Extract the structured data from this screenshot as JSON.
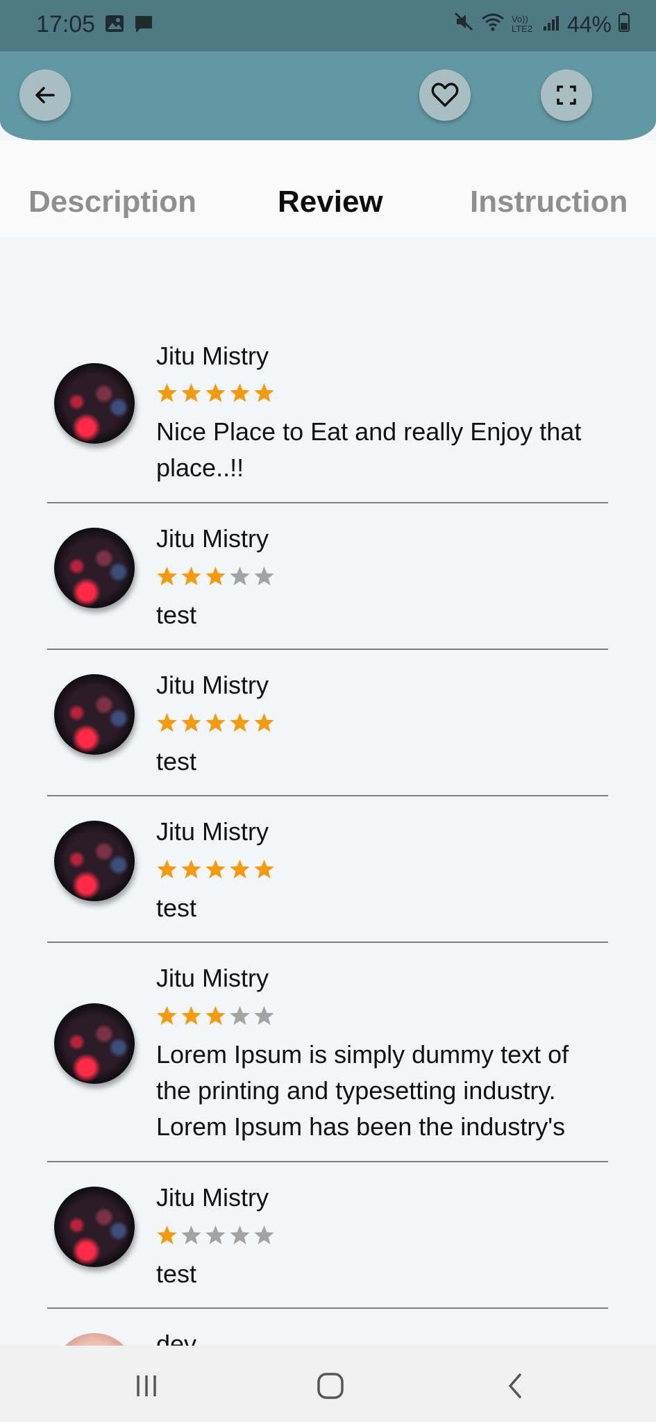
{
  "status_bar": {
    "time": "17:05",
    "battery": "44%",
    "network": "Vo)) LTE2"
  },
  "header": {
    "back_icon": "arrow-left-icon",
    "favorite_icon": "heart-icon",
    "fullscreen_icon": "fullscreen-icon"
  },
  "tabs": [
    {
      "label": "Description",
      "active": false
    },
    {
      "label": "Review",
      "active": true
    },
    {
      "label": "Instruction",
      "active": false
    }
  ],
  "colors": {
    "header": "#6198a3",
    "status_bar": "#4f7a84",
    "star_filled": "#f59a0c",
    "star_empty": "#a3a3a3"
  },
  "reviews": [
    {
      "name": "Jitu Mistry",
      "rating": 5,
      "text": "Nice Place to Eat and really Enjoy that place..!!"
    },
    {
      "name": "Jitu Mistry",
      "rating": 3,
      "text": "test"
    },
    {
      "name": "Jitu Mistry",
      "rating": 5,
      "text": "test"
    },
    {
      "name": "Jitu Mistry",
      "rating": 5,
      "text": "test"
    },
    {
      "name": "Jitu Mistry",
      "rating": 3,
      "text": "Lorem Ipsum is simply dummy text of the printing and typesetting industry. Lorem Ipsum has been the industry's"
    },
    {
      "name": "Jitu Mistry",
      "rating": 1,
      "text": "test"
    },
    {
      "name": "dev",
      "rating": 0,
      "text": ""
    }
  ],
  "nav": {
    "recents_icon": "recents-icon",
    "home_icon": "home-icon",
    "back_icon": "back-chevron-icon"
  }
}
